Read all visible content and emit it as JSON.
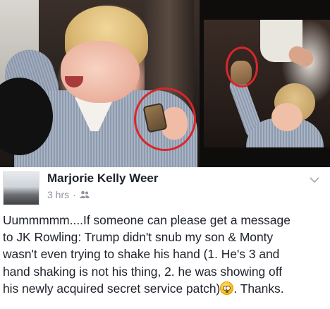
{
  "photos": {
    "left_highlight_color": "#d8262b",
    "right_highlight_color": "#d8262b"
  },
  "post": {
    "author_name": "Marjorie Kelly Weer",
    "timestamp": "3 hrs",
    "separator": "·",
    "audience_icon": "friends-icon",
    "options_icon": "chevron-down-icon",
    "text_lines": [
      "Uummmmm....If someone can please get a message",
      "to JK Rowling: Trump didn't snub my son & Monty",
      "wasn't even trying to shake his hand (1. He's 3 and",
      "hand shaking is not his thing, 2. he was showing off",
      "his newly acquired secret service patch)"
    ],
    "emoji_icon": "flushed-face-emoji",
    "text_tail": ". Thanks."
  }
}
